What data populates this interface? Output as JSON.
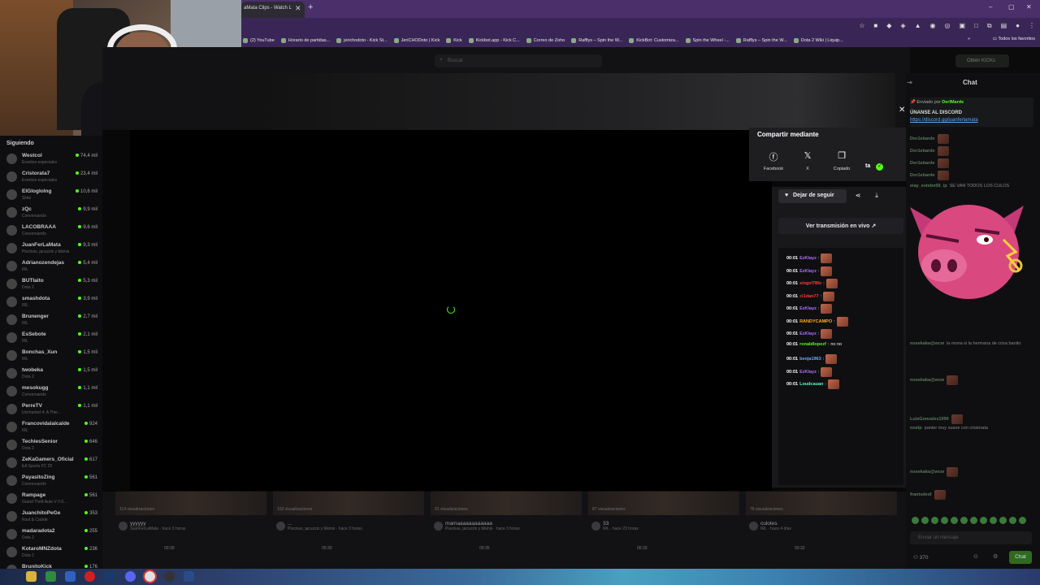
{
  "browser": {
    "tab_title": "aMata Clips - Watch L",
    "new_tab": "+",
    "window_controls": [
      "–",
      "▢",
      "✕"
    ],
    "bookmarks": [
      "(2) YouTube",
      "Horario de partidas...",
      "jerichodoto - Kick St...",
      "JeriCHODoto | Kick",
      "Kick",
      "Kickbot.app - Kick C...",
      "Correo de Zoho",
      "Rafflys – Spin the W...",
      "KickBot: Customiza...",
      "Spin the Wheel -...",
      "Rafflys – Spin the W...",
      "Dota 2 Wiki | Liquip..."
    ],
    "bookmarks_more": "»",
    "bookmarks_all": "Todos los favoritos"
  },
  "sidebar": {
    "title": "Siguiendo",
    "channels": [
      {
        "name": "Westcol",
        "category": "Eventos especiales",
        "viewers": "74,4 mil"
      },
      {
        "name": "Cristorata7",
        "category": "Eventos especiales",
        "viewers": "23,4 mil"
      },
      {
        "name": "ElGloglolng",
        "category": "Slots",
        "viewers": "10,6 mil"
      },
      {
        "name": "zQc",
        "category": "Conversando",
        "viewers": "9,9 mil"
      },
      {
        "name": "LACOBRAAA",
        "category": "Conversando",
        "viewers": "9,6 mil"
      },
      {
        "name": "JuanFerLaMata",
        "category": "Piscinas, jacuzzis y bikinis",
        "viewers": "9,3 mil"
      },
      {
        "name": "Adrianozendejas",
        "category": "IRL",
        "viewers": "5,4 mil"
      },
      {
        "name": "BUTIaito",
        "category": "Dota 2",
        "viewers": "5,3 mil"
      },
      {
        "name": "smashdota",
        "category": "IRL",
        "viewers": "3,9 mil"
      },
      {
        "name": "Brunenger",
        "category": "IRL",
        "viewers": "2,7 mil"
      },
      {
        "name": "EsSebote",
        "category": "IRL",
        "viewers": "2,1 mil"
      },
      {
        "name": "Bonchas_Xun",
        "category": "IRL",
        "viewers": "1,5 mil"
      },
      {
        "name": "twobeka",
        "category": "Dota 2",
        "viewers": "1,5 mil"
      },
      {
        "name": "mesokugg",
        "category": "Conversando",
        "viewers": "1,1 mil"
      },
      {
        "name": "PerreTV",
        "category": "Uncharted 4: A Thie...",
        "viewers": "1,1 mil"
      },
      {
        "name": "Francovidalalcalde",
        "category": "IRL",
        "viewers": "924"
      },
      {
        "name": "TechiesSenior",
        "category": "Dota 2",
        "viewers": "646"
      },
      {
        "name": "ZeKaGamers_Oficial",
        "category": "EA Sports FC 25",
        "viewers": "617"
      },
      {
        "name": "PayasitoZing",
        "category": "Conversando",
        "viewers": "561"
      },
      {
        "name": "Rampage",
        "category": "Grand Theft Auto V II 0...",
        "viewers": "561"
      },
      {
        "name": "JuanchitoPeGe",
        "category": "Rust & Cackle",
        "viewers": "353"
      },
      {
        "name": "madaradota2",
        "category": "Dota 2",
        "viewers": "255"
      },
      {
        "name": "KotaroMNZdota",
        "category": "Dota 2",
        "viewers": "236"
      },
      {
        "name": "BrunitoKick",
        "category": "",
        "viewers": "176"
      }
    ]
  },
  "topbar": {
    "search_placeholder": "Buscar",
    "get_kicks": "Obtén KICKs"
  },
  "share": {
    "title": "Compartir mediante",
    "options": [
      {
        "icon": "facebook-icon",
        "label": "Facebook"
      },
      {
        "icon": "x-icon",
        "label": "X"
      },
      {
        "icon": "copy-icon",
        "label": "Copiado"
      }
    ],
    "extra": "ta"
  },
  "clip_panel": {
    "follow_label": "Dejar de seguir",
    "live_label": "Ver transmisión en vivo ↗",
    "messages": [
      {
        "time": "00:01",
        "user": "EzKlayz",
        "color": "#b06bff",
        "text": ""
      },
      {
        "time": "00:01",
        "user": "EzKlayz",
        "color": "#b06bff",
        "text": ""
      },
      {
        "time": "00:01",
        "user": "singel78fo",
        "color": "#ff3b3b",
        "text": ""
      },
      {
        "time": "00:01",
        "user": "ci1dan77",
        "color": "#ff3b3b",
        "text": ""
      },
      {
        "time": "00:01",
        "user": "EzKlayz",
        "color": "#b06bff",
        "text": ""
      },
      {
        "time": "00:01",
        "user": "RANDYCAMPO",
        "color": "#ffb020",
        "text": ""
      },
      {
        "time": "00:01",
        "user": "EzKlayz",
        "color": "#b06bff",
        "text": ""
      },
      {
        "time": "00:01",
        "user": "ronaldlopezf",
        "color": "#53fc18",
        "text": "no no"
      },
      {
        "time": "00:01",
        "user": "benja1963",
        "color": "#6aaaff",
        "text": ""
      },
      {
        "time": "00:01",
        "user": "EzKlayz",
        "color": "#b06bff",
        "text": ""
      },
      {
        "time": "00:01",
        "user": "Loudcauan",
        "color": "#53fcc8",
        "text": ""
      }
    ]
  },
  "chat": {
    "title": "Chat",
    "pinned_by_label": "Enviado por",
    "pinned_by_user": "DerlMarde",
    "pinned_text": "ÚNANSE AL DISCORD",
    "pinned_link": "https://discord.gg/juanferlamata",
    "messages": [
      {
        "user": "Dor1ebarde",
        "text": ""
      },
      {
        "user": "Dor1ebarde",
        "text": ""
      },
      {
        "user": "Dor1ebarde",
        "text": ""
      },
      {
        "user": "Dor1ebarde",
        "text": ""
      },
      {
        "user": "eiay_estebn00_ip",
        "text": "SE VAN TODOS LOS CULOS"
      },
      {
        "user": "nosekaka@wcw",
        "text": "la mona si la hermana de crisa banito"
      },
      {
        "user": "nosekaka@wcw",
        "text": ""
      },
      {
        "user": "LuisGonzalez1990",
        "text": ""
      },
      {
        "user": "noelp",
        "text": "panter muy suave con cristorata"
      },
      {
        "user": "nosekaka@wcw",
        "text": ""
      },
      {
        "user": "frantsdeol",
        "text": ""
      }
    ],
    "input_placeholder": "Enviar un mensaje",
    "viewers": "370",
    "send_label": "Chat"
  },
  "clips": [
    {
      "views": "114 visualizaciones",
      "title": "yyyyyy",
      "sub": "JuanFerLaMata · hace 3 horas",
      "duration": "00:30"
    },
    {
      "views": "103 visualizaciones",
      "title": "...",
      "sub": "Piscinas, jacuzzis y bikinis · hace 3 horas",
      "duration": "00:30"
    },
    {
      "views": "91 visualizaciones",
      "title": "mamaaaaaaaaaaaa",
      "sub": "Piscinas, jacuzzis y bikinis · hace 3 horas",
      "duration": "00:35"
    },
    {
      "views": "87 visualizaciones",
      "title": "33",
      "sub": "IRL · hace 23 horas",
      "duration": "00:33"
    },
    {
      "views": "76 visualizaciones",
      "title": "culotes",
      "sub": "IRL · hace 4 días",
      "duration": "00:32"
    }
  ],
  "colors": {
    "kick_green": "#53fc18",
    "browser_purple": "#4a2f6b",
    "panel_bg": "#18181b"
  }
}
